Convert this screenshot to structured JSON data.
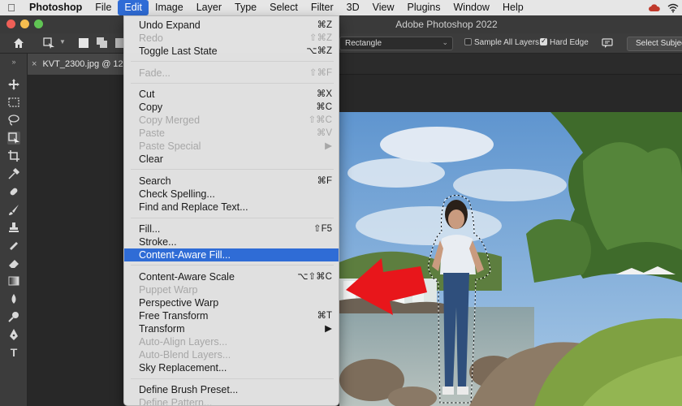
{
  "menubar": {
    "items": [
      "Photoshop",
      "File",
      "Edit",
      "Image",
      "Layer",
      "Type",
      "Select",
      "Filter",
      "3D",
      "View",
      "Plugins",
      "Window",
      "Help"
    ],
    "active": "Edit"
  },
  "titlebar": {
    "title": "Adobe Photoshop 2022"
  },
  "options_bar": {
    "selection_mode": "Rectangle",
    "sample_all_layers": {
      "label": "Sample All Layers",
      "checked": false
    },
    "hard_edge": {
      "label": "Hard Edge",
      "checked": true
    },
    "select_subject_label": "Select Subjec"
  },
  "document_tab": {
    "name": "KVT_2300.jpg @ 12."
  },
  "edit_menu": {
    "items": [
      {
        "label": "Undo Expand",
        "shortcut": "⌘Z",
        "disabled": false
      },
      {
        "label": "Redo",
        "shortcut": "⇧⌘Z",
        "disabled": true
      },
      {
        "label": "Toggle Last State",
        "shortcut": "⌥⌘Z",
        "disabled": false
      },
      {
        "label": "Fade...",
        "shortcut": "⇧⌘F",
        "disabled": true
      },
      {
        "label": "Cut",
        "shortcut": "⌘X",
        "disabled": false
      },
      {
        "label": "Copy",
        "shortcut": "⌘C",
        "disabled": false
      },
      {
        "label": "Copy Merged",
        "shortcut": "⇧⌘C",
        "disabled": true
      },
      {
        "label": "Paste",
        "shortcut": "⌘V",
        "disabled": true
      },
      {
        "label": "Paste Special",
        "shortcut": "▶",
        "disabled": true
      },
      {
        "label": "Clear",
        "shortcut": "",
        "disabled": false
      },
      {
        "label": "Search",
        "shortcut": "⌘F",
        "disabled": false
      },
      {
        "label": "Check Spelling...",
        "shortcut": "",
        "disabled": false
      },
      {
        "label": "Find and Replace Text...",
        "shortcut": "",
        "disabled": false
      },
      {
        "label": "Fill...",
        "shortcut": "⇧F5",
        "disabled": false
      },
      {
        "label": "Stroke...",
        "shortcut": "",
        "disabled": false
      },
      {
        "label": "Content-Aware Fill...",
        "shortcut": "",
        "disabled": false,
        "highlighted": true
      },
      {
        "label": "Content-Aware Scale",
        "shortcut": "⌥⇧⌘C",
        "disabled": false
      },
      {
        "label": "Puppet Warp",
        "shortcut": "",
        "disabled": true
      },
      {
        "label": "Perspective Warp",
        "shortcut": "",
        "disabled": false
      },
      {
        "label": "Free Transform",
        "shortcut": "⌘T",
        "disabled": false
      },
      {
        "label": "Transform",
        "shortcut": "▶",
        "disabled": false
      },
      {
        "label": "Auto-Align Layers...",
        "shortcut": "",
        "disabled": true
      },
      {
        "label": "Auto-Blend Layers...",
        "shortcut": "",
        "disabled": true
      },
      {
        "label": "Sky Replacement...",
        "shortcut": "",
        "disabled": false
      },
      {
        "label": "Define Brush Preset...",
        "shortcut": "",
        "disabled": false
      },
      {
        "label": "Define Pattern...",
        "shortcut": "",
        "disabled": true
      }
    ]
  },
  "colors": {
    "menu_highlight": "#2f6cd6",
    "arrow": "#e8161b",
    "app_bg": "#2b2b2b"
  },
  "icons": [
    "apple-icon",
    "home-icon",
    "marquee-icon",
    "move-icon",
    "lasso-icon",
    "crop-icon",
    "eyedropper-icon",
    "brush-icon",
    "stamp-icon",
    "eraser-icon",
    "gradient-icon",
    "pen-icon"
  ]
}
